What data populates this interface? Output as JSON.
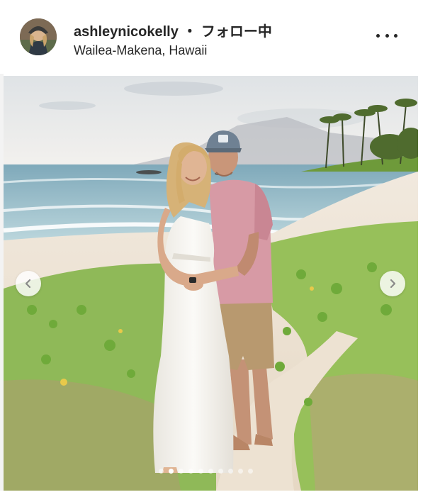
{
  "post_header": {
    "username": "ashleynicokelly",
    "separator": "・",
    "follow_status": "フォロー中",
    "location": "Wailea-Makena, Hawaii",
    "avatar_icon": "profile-avatar",
    "more_icon": "more-options-icon"
  },
  "carousel": {
    "photo_icon": "beach-couple-photo",
    "prev_icon": "chevron-left-icon",
    "next_icon": "chevron-right-icon",
    "slide_count": 10,
    "active_slide": 2
  },
  "colors": {
    "text": "#262626",
    "sky": "#e9ecee",
    "ocean": "#9fc4cf",
    "sand": "#efe7dc",
    "grass": "#8cbf4a",
    "shirt": "#d89aa4",
    "shorts": "#b99a6e",
    "dress": "#f3f1ec",
    "cap": "#6f8193"
  }
}
